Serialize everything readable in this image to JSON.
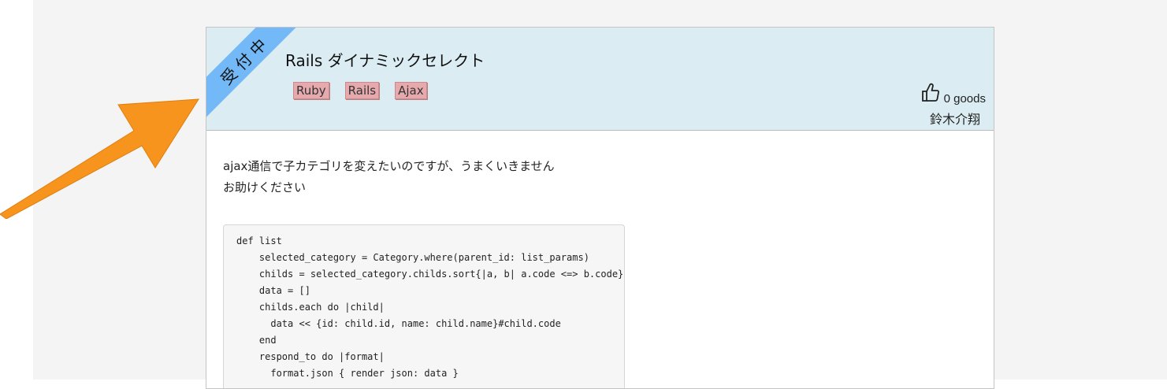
{
  "question": {
    "status_ribbon": "受付中",
    "title": "Rails ダイナミックセレクト",
    "tags": [
      "Ruby",
      "Rails",
      "Ajax"
    ],
    "goods_count_label": "0 goods",
    "author": "鈴木介翔",
    "body_lines": [
      "ajax通信で子カテゴリを変えたいのですが、うまくいきません",
      "お助けください"
    ],
    "code_lines": [
      "def list",
      "    selected_category = Category.where(parent_id: list_params)",
      "    childs = selected_category.childs.sort{|a, b| a.code <=> b.code}",
      "    data = []",
      "    childs.each do |child|",
      "      data << {id: child.id, name: child.name}#child.code",
      "    end",
      "    respond_to do |format|",
      "      format.json { render json: data }"
    ]
  },
  "colors": {
    "header_bg": "#dbedf3",
    "ribbon": "#74b9f7",
    "tag_bg": "#e6a9ad",
    "arrow": "#f7941d"
  },
  "icons": {
    "like": "thumbs-up-icon",
    "annotation": "arrow-icon"
  }
}
